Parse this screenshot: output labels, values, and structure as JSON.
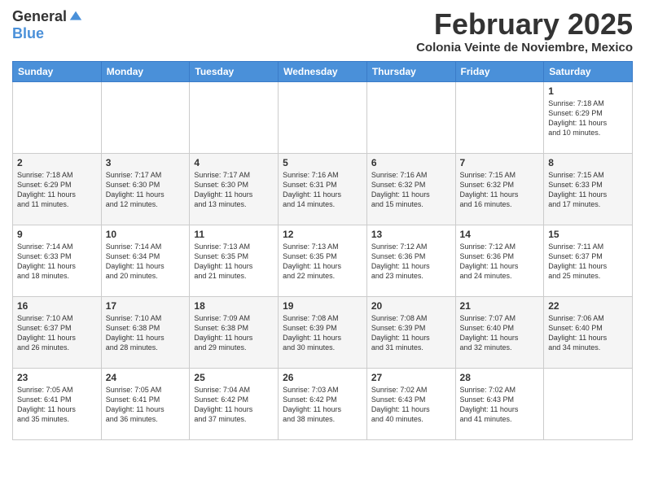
{
  "logo": {
    "general": "General",
    "blue": "Blue"
  },
  "title": "February 2025",
  "subtitle": "Colonia Veinte de Noviembre, Mexico",
  "days_of_week": [
    "Sunday",
    "Monday",
    "Tuesday",
    "Wednesday",
    "Thursday",
    "Friday",
    "Saturday"
  ],
  "weeks": [
    [
      {
        "day": "",
        "info": ""
      },
      {
        "day": "",
        "info": ""
      },
      {
        "day": "",
        "info": ""
      },
      {
        "day": "",
        "info": ""
      },
      {
        "day": "",
        "info": ""
      },
      {
        "day": "",
        "info": ""
      },
      {
        "day": "1",
        "info": "Sunrise: 7:18 AM\nSunset: 6:29 PM\nDaylight: 11 hours\nand 10 minutes."
      }
    ],
    [
      {
        "day": "2",
        "info": "Sunrise: 7:18 AM\nSunset: 6:29 PM\nDaylight: 11 hours\nand 11 minutes."
      },
      {
        "day": "3",
        "info": "Sunrise: 7:17 AM\nSunset: 6:30 PM\nDaylight: 11 hours\nand 12 minutes."
      },
      {
        "day": "4",
        "info": "Sunrise: 7:17 AM\nSunset: 6:30 PM\nDaylight: 11 hours\nand 13 minutes."
      },
      {
        "day": "5",
        "info": "Sunrise: 7:16 AM\nSunset: 6:31 PM\nDaylight: 11 hours\nand 14 minutes."
      },
      {
        "day": "6",
        "info": "Sunrise: 7:16 AM\nSunset: 6:32 PM\nDaylight: 11 hours\nand 15 minutes."
      },
      {
        "day": "7",
        "info": "Sunrise: 7:15 AM\nSunset: 6:32 PM\nDaylight: 11 hours\nand 16 minutes."
      },
      {
        "day": "8",
        "info": "Sunrise: 7:15 AM\nSunset: 6:33 PM\nDaylight: 11 hours\nand 17 minutes."
      }
    ],
    [
      {
        "day": "9",
        "info": "Sunrise: 7:14 AM\nSunset: 6:33 PM\nDaylight: 11 hours\nand 18 minutes."
      },
      {
        "day": "10",
        "info": "Sunrise: 7:14 AM\nSunset: 6:34 PM\nDaylight: 11 hours\nand 20 minutes."
      },
      {
        "day": "11",
        "info": "Sunrise: 7:13 AM\nSunset: 6:35 PM\nDaylight: 11 hours\nand 21 minutes."
      },
      {
        "day": "12",
        "info": "Sunrise: 7:13 AM\nSunset: 6:35 PM\nDaylight: 11 hours\nand 22 minutes."
      },
      {
        "day": "13",
        "info": "Sunrise: 7:12 AM\nSunset: 6:36 PM\nDaylight: 11 hours\nand 23 minutes."
      },
      {
        "day": "14",
        "info": "Sunrise: 7:12 AM\nSunset: 6:36 PM\nDaylight: 11 hours\nand 24 minutes."
      },
      {
        "day": "15",
        "info": "Sunrise: 7:11 AM\nSunset: 6:37 PM\nDaylight: 11 hours\nand 25 minutes."
      }
    ],
    [
      {
        "day": "16",
        "info": "Sunrise: 7:10 AM\nSunset: 6:37 PM\nDaylight: 11 hours\nand 26 minutes."
      },
      {
        "day": "17",
        "info": "Sunrise: 7:10 AM\nSunset: 6:38 PM\nDaylight: 11 hours\nand 28 minutes."
      },
      {
        "day": "18",
        "info": "Sunrise: 7:09 AM\nSunset: 6:38 PM\nDaylight: 11 hours\nand 29 minutes."
      },
      {
        "day": "19",
        "info": "Sunrise: 7:08 AM\nSunset: 6:39 PM\nDaylight: 11 hours\nand 30 minutes."
      },
      {
        "day": "20",
        "info": "Sunrise: 7:08 AM\nSunset: 6:39 PM\nDaylight: 11 hours\nand 31 minutes."
      },
      {
        "day": "21",
        "info": "Sunrise: 7:07 AM\nSunset: 6:40 PM\nDaylight: 11 hours\nand 32 minutes."
      },
      {
        "day": "22",
        "info": "Sunrise: 7:06 AM\nSunset: 6:40 PM\nDaylight: 11 hours\nand 34 minutes."
      }
    ],
    [
      {
        "day": "23",
        "info": "Sunrise: 7:05 AM\nSunset: 6:41 PM\nDaylight: 11 hours\nand 35 minutes."
      },
      {
        "day": "24",
        "info": "Sunrise: 7:05 AM\nSunset: 6:41 PM\nDaylight: 11 hours\nand 36 minutes."
      },
      {
        "day": "25",
        "info": "Sunrise: 7:04 AM\nSunset: 6:42 PM\nDaylight: 11 hours\nand 37 minutes."
      },
      {
        "day": "26",
        "info": "Sunrise: 7:03 AM\nSunset: 6:42 PM\nDaylight: 11 hours\nand 38 minutes."
      },
      {
        "day": "27",
        "info": "Sunrise: 7:02 AM\nSunset: 6:43 PM\nDaylight: 11 hours\nand 40 minutes."
      },
      {
        "day": "28",
        "info": "Sunrise: 7:02 AM\nSunset: 6:43 PM\nDaylight: 11 hours\nand 41 minutes."
      },
      {
        "day": "",
        "info": ""
      }
    ]
  ]
}
